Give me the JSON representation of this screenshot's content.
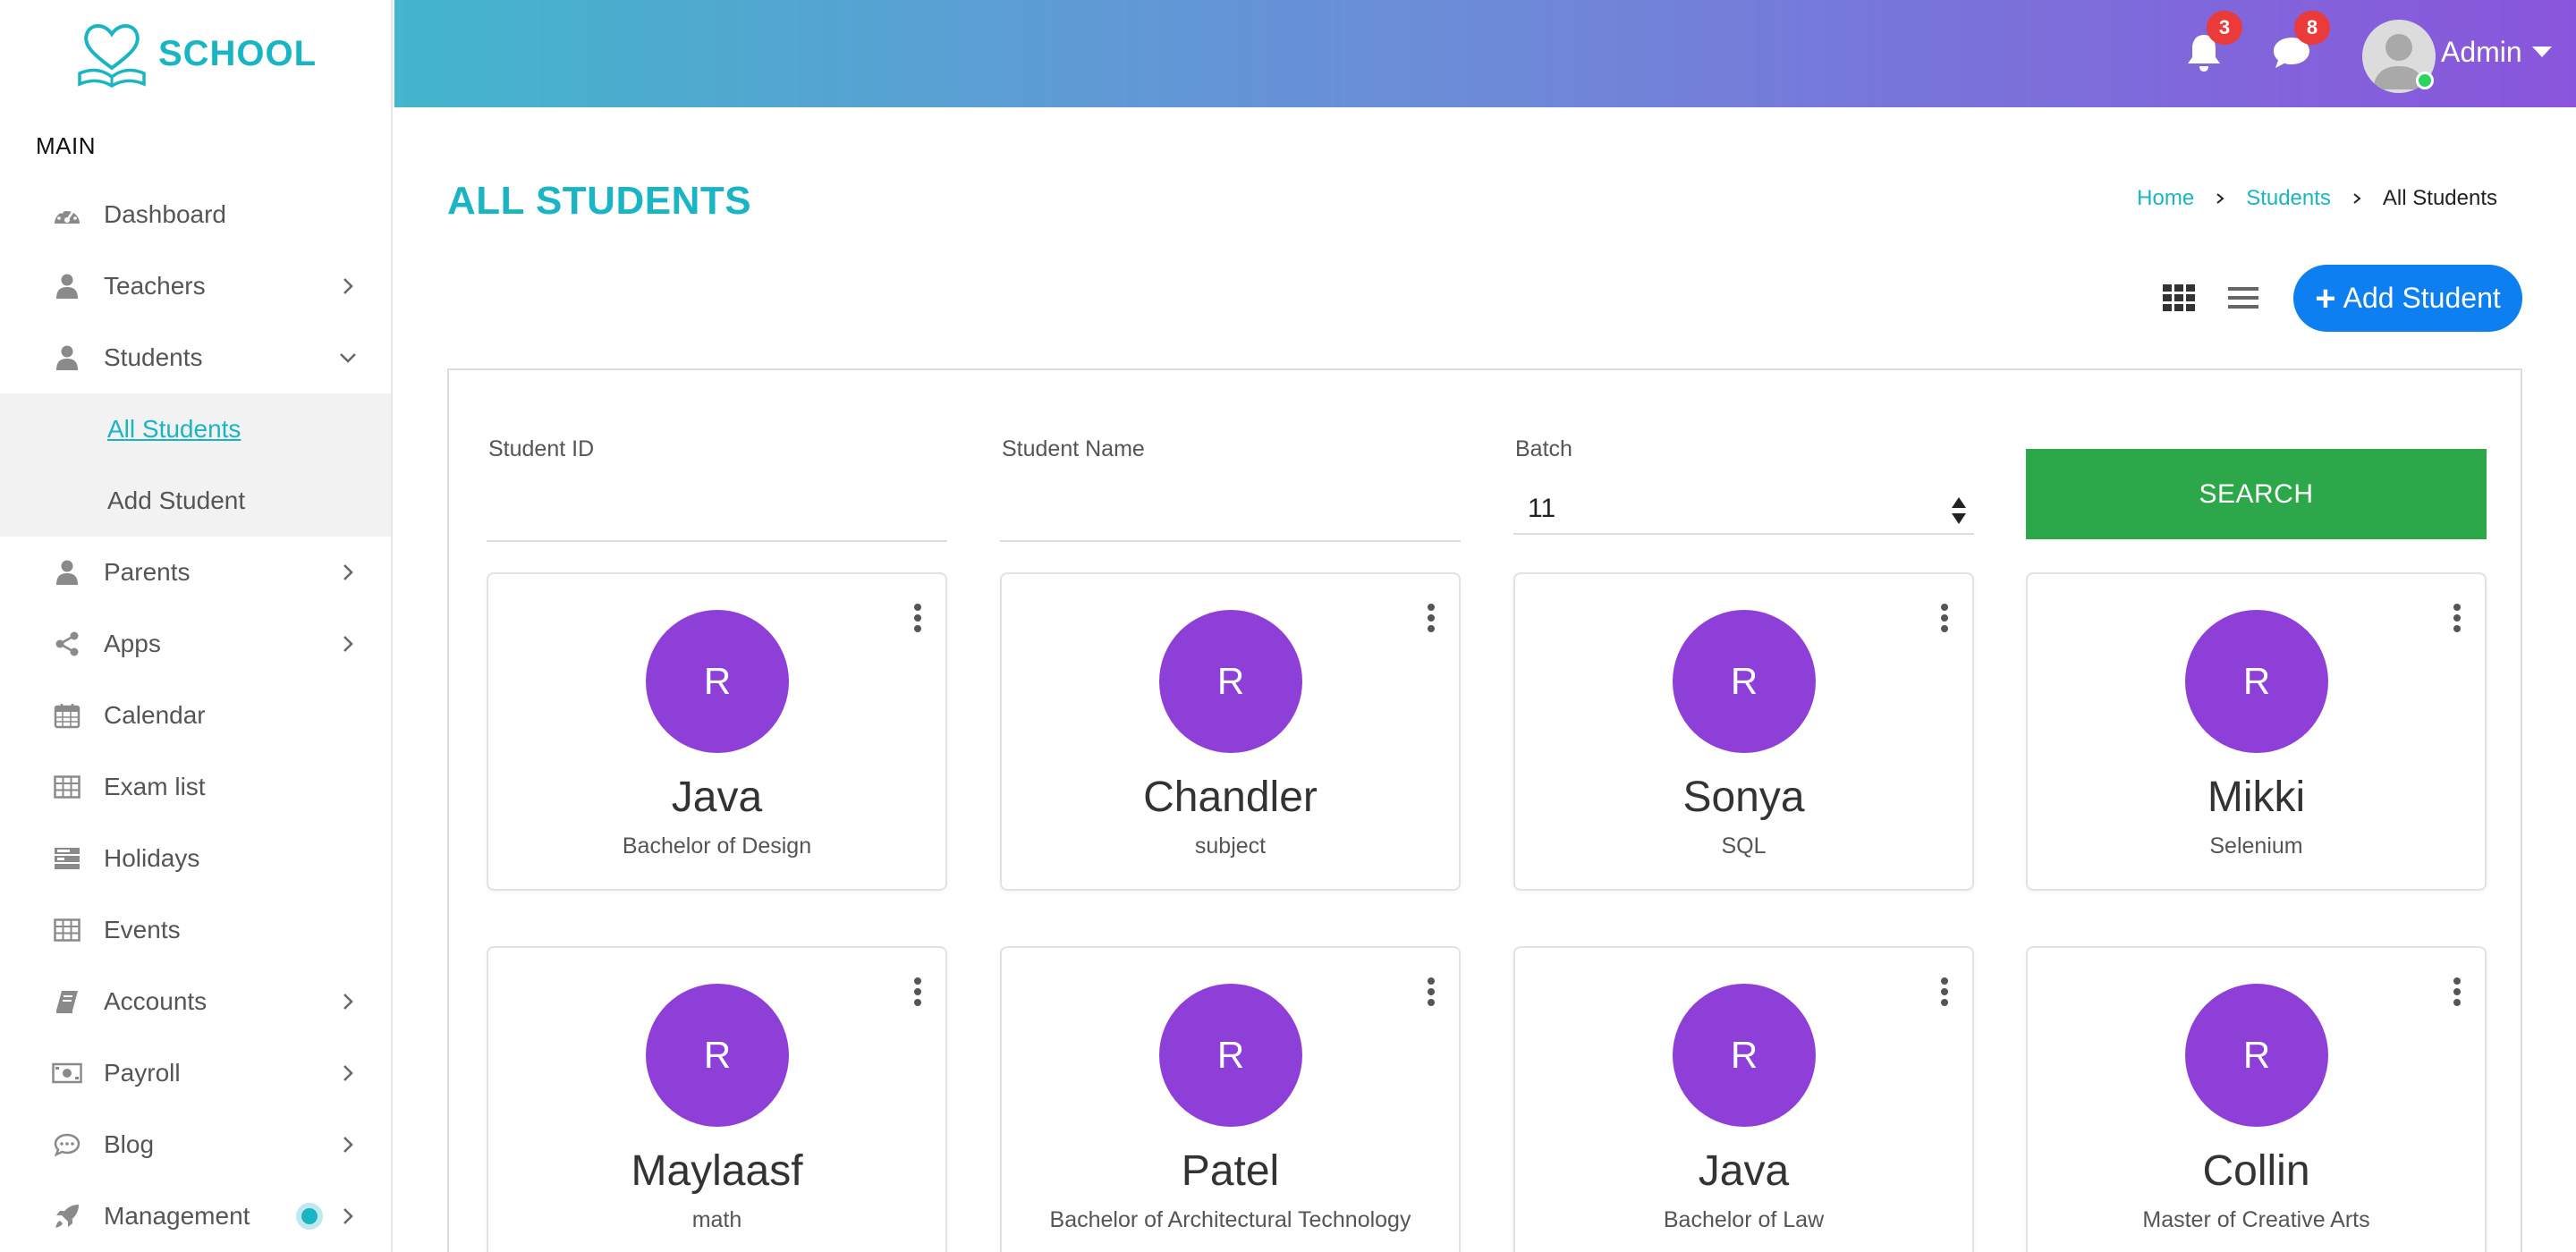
{
  "brand": {
    "name": "SCHOOL"
  },
  "sidebar": {
    "section": "MAIN",
    "items": [
      {
        "label": "Dashboard"
      },
      {
        "label": "Teachers"
      },
      {
        "label": "Students"
      },
      {
        "label": "Parents"
      },
      {
        "label": "Apps"
      },
      {
        "label": "Calendar"
      },
      {
        "label": "Exam list"
      },
      {
        "label": "Holidays"
      },
      {
        "label": "Events"
      },
      {
        "label": "Accounts"
      },
      {
        "label": "Payroll"
      },
      {
        "label": "Blog"
      },
      {
        "label": "Management"
      }
    ],
    "students_sub": [
      {
        "label": "All Students"
      },
      {
        "label": "Add Student"
      }
    ]
  },
  "header": {
    "notifications_count": "3",
    "messages_count": "8",
    "user_name": "Admin"
  },
  "page": {
    "title": "ALL STUDENTS",
    "breadcrumb": [
      "Home",
      "Students",
      "All Students"
    ],
    "add_button": "Add Student"
  },
  "filters": {
    "student_id_label": "Student ID",
    "student_name_label": "Student Name",
    "batch_label": "Batch",
    "batch_value": "11",
    "search_button": "SEARCH"
  },
  "students": [
    {
      "initial": "R",
      "name": "Java",
      "subject": "Bachelor of Design"
    },
    {
      "initial": "R",
      "name": "Chandler",
      "subject": "subject"
    },
    {
      "initial": "R",
      "name": "Sonya",
      "subject": "SQL"
    },
    {
      "initial": "R",
      "name": "Mikki",
      "subject": "Selenium"
    },
    {
      "initial": "R",
      "name": "Maylaasf",
      "subject": "math"
    },
    {
      "initial": "R",
      "name": "Patel",
      "subject": "Bachelor of Architectural Technology"
    },
    {
      "initial": "R",
      "name": "Java",
      "subject": "Bachelor of Law"
    },
    {
      "initial": "R",
      "name": "Collin",
      "subject": "Master of Creative Arts"
    }
  ],
  "colors": {
    "accent": "#1ab5c4",
    "primary_button": "#0d7ff0",
    "search_button": "#2ca84a",
    "avatar_circle": "#8e3fd8",
    "badge": "#ea3a3a"
  }
}
